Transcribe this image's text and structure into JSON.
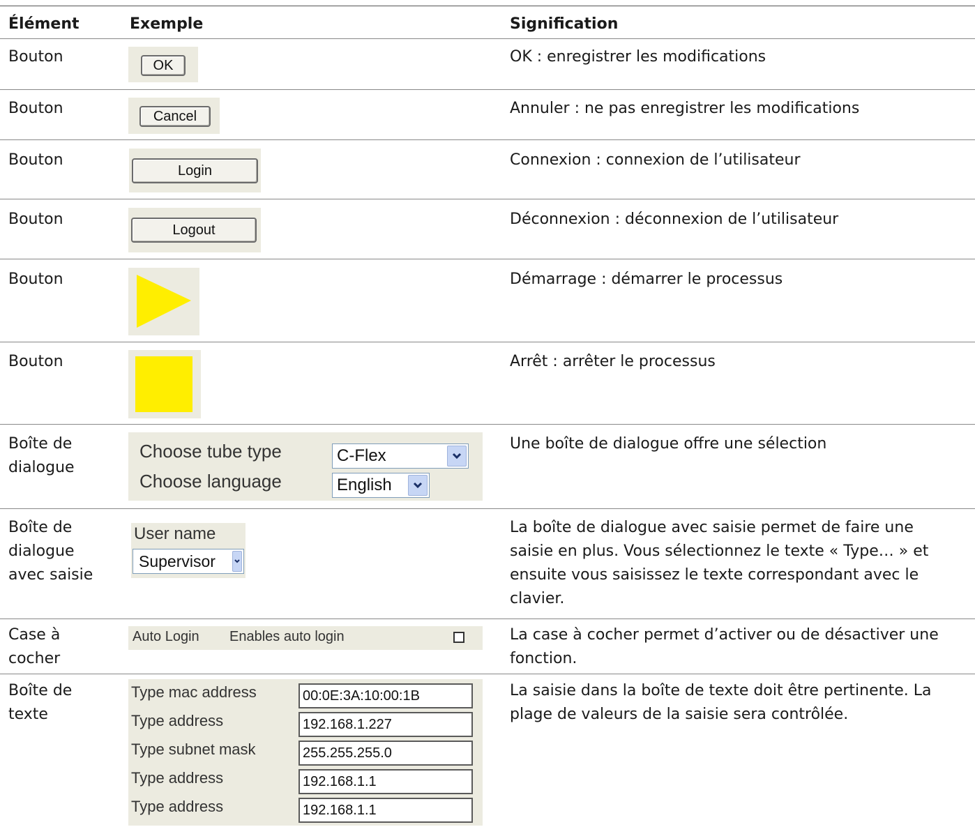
{
  "headers": {
    "element": "Élément",
    "example": "Exemple",
    "meaning": "Signification"
  },
  "rows": [
    {
      "element": "Bouton",
      "meaning": "OK : enregistrer les modifications",
      "example": {
        "button": "OK"
      }
    },
    {
      "element": "Bouton",
      "meaning": "Annuler : ne pas enregistrer les modifications",
      "example": {
        "button": "Cancel"
      }
    },
    {
      "element": "Bouton",
      "meaning": "Connexion : connexion de l’utilisateur",
      "example": {
        "button": "Login"
      }
    },
    {
      "element": "Bouton",
      "meaning": "Déconnexion : déconnexion de l’utilisateur",
      "example": {
        "button": "Logout"
      }
    },
    {
      "element": "Bouton",
      "meaning": "Démarrage : démarrer le processus",
      "example": {
        "icon": "play-icon",
        "color": "#ffee00"
      }
    },
    {
      "element": "Bouton",
      "meaning": "Arrêt : arrêter le processus",
      "example": {
        "icon": "stop-icon",
        "color": "#ffee00"
      }
    },
    {
      "element": "Boîte de dialogue",
      "meaning": "Une boîte de dialogue offre une sélection",
      "example": {
        "tube_label": "Choose tube type",
        "tube_value": "C-Flex",
        "language_label": "Choose language",
        "language_value": "English"
      }
    },
    {
      "element": "Boîte de dialogue avec saisie",
      "meaning": "La boîte de dialogue avec saisie permet de faire une saisie en plus. Vous sélectionnez le texte « Type… » et ensuite vous saisissez le texte correspondant avec le clavier.",
      "example": {
        "label": "User name",
        "value": "Supervisor"
      }
    },
    {
      "element": "Case à cocher",
      "meaning": "La case à cocher permet d’activer ou de désactiver une fonction.",
      "example": {
        "label": "Auto Login",
        "description": "Enables auto login",
        "checked": false
      }
    },
    {
      "element": "Boîte de texte",
      "meaning": "La saisie dans la boîte de texte doit être pertinente. La plage de valeurs de la saisie sera contrôlée.",
      "example": {
        "fields": [
          {
            "label": "Type mac address",
            "value": "00:0E:3A:10:00:1B"
          },
          {
            "label": "Type address",
            "value": "192.168.1.227"
          },
          {
            "label": "Type subnet mask",
            "value": "255.255.255.0"
          },
          {
            "label": "Type address",
            "value": "192.168.1.1"
          },
          {
            "label": "Type address",
            "value": "192.168.1.1"
          }
        ]
      }
    }
  ],
  "colors": {
    "panel_bg": "#ecebe0",
    "accent_yellow": "#ffee00",
    "rule": "#888888"
  }
}
